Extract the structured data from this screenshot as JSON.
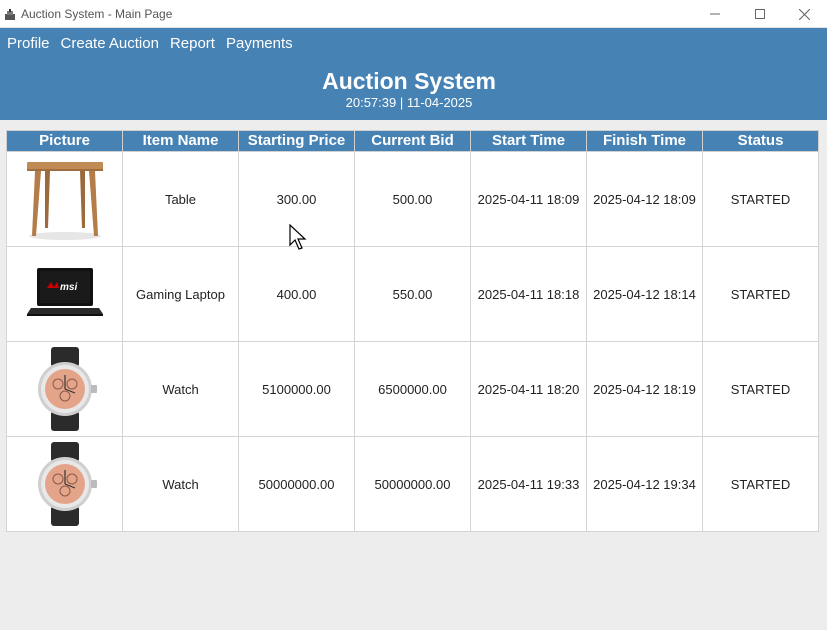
{
  "window": {
    "title": "Auction System - Main Page",
    "controls": {
      "minimize": "—",
      "maximize": "☐",
      "close": "✕"
    }
  },
  "menu": {
    "items": [
      "Profile",
      "Create Auction",
      "Report",
      "Payments"
    ]
  },
  "header": {
    "title": "Auction System",
    "clock": "20:57:39 | 11-04-2025",
    "color": "#4682b4"
  },
  "table": {
    "columns": [
      "Picture",
      "Item Name",
      "Starting Price",
      "Current Bid",
      "Start Time",
      "Finish Time",
      "Status"
    ],
    "rows": [
      {
        "picture": "table-image",
        "item_name": "Table",
        "starting_price": "300.00",
        "current_bid": "500.00",
        "start_time": "2025-04-11 18:09",
        "finish_time": "2025-04-12 18:09",
        "status": "STARTED"
      },
      {
        "picture": "laptop-image",
        "item_name": "Gaming Laptop",
        "starting_price": "400.00",
        "current_bid": "550.00",
        "start_time": "2025-04-11 18:18",
        "finish_time": "2025-04-12 18:14",
        "status": "STARTED"
      },
      {
        "picture": "watch-image",
        "item_name": "Watch",
        "starting_price": "5100000.00",
        "current_bid": "6500000.00",
        "start_time": "2025-04-11 18:20",
        "finish_time": "2025-04-12 18:19",
        "status": "STARTED"
      },
      {
        "picture": "watch-image",
        "item_name": "Watch",
        "starting_price": "50000000.00",
        "current_bid": "50000000.00",
        "start_time": "2025-04-11 19:33",
        "finish_time": "2025-04-12 19:34",
        "status": "STARTED"
      }
    ]
  },
  "laptop_logo_text": "msi"
}
